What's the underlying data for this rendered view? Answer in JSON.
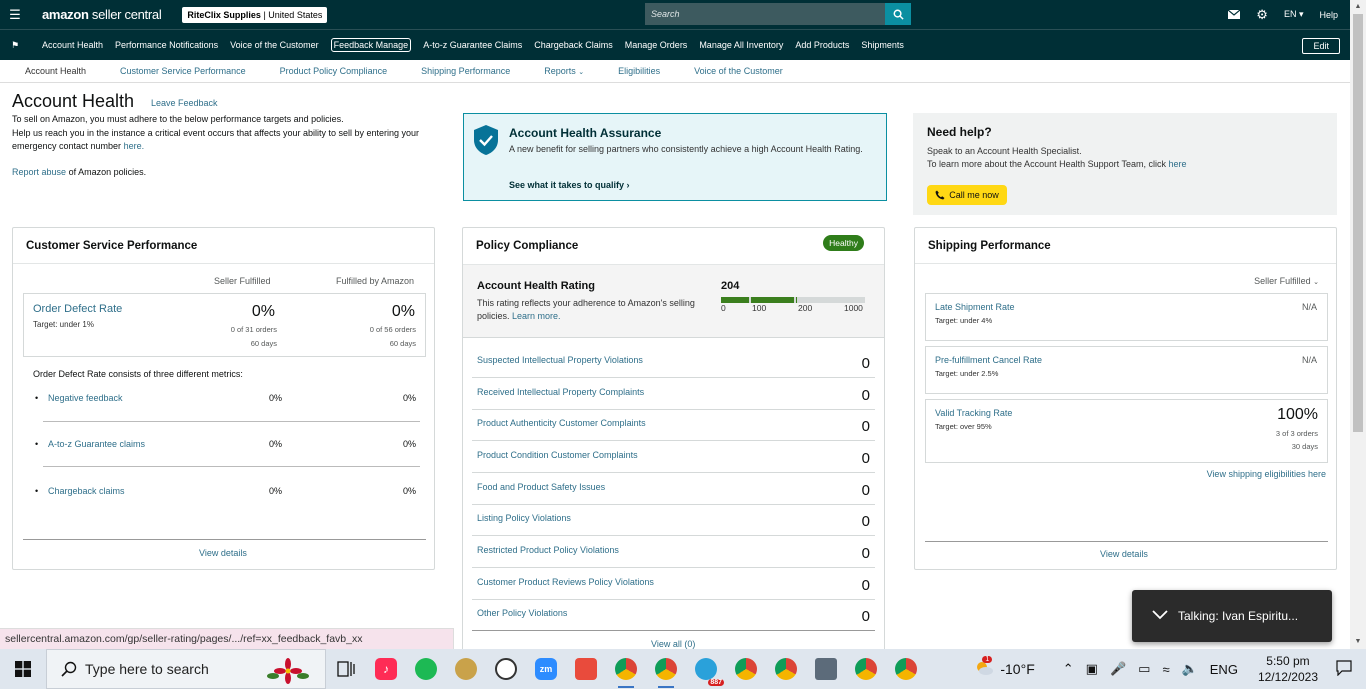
{
  "topbar": {
    "logo": "amazon",
    "logo_suffix": "seller central",
    "store_name": "RiteClix Supplies",
    "store_region": "United States",
    "search_placeholder": "Search",
    "lang": "EN",
    "help": "Help"
  },
  "nav": {
    "items": [
      {
        "label": "Account Health"
      },
      {
        "label": "Performance Notifications"
      },
      {
        "label": "Voice of the Customer"
      },
      {
        "label": "Feedback Manage"
      },
      {
        "label": "A-to-z Guarantee Claims"
      },
      {
        "label": "Chargeback Claims"
      },
      {
        "label": "Manage Orders"
      },
      {
        "label": "Manage All Inventory"
      },
      {
        "label": "Add Products"
      },
      {
        "label": "Shipments"
      }
    ],
    "edit": "Edit"
  },
  "subnav": {
    "items": [
      {
        "label": "Account Health"
      },
      {
        "label": "Customer Service Performance"
      },
      {
        "label": "Product Policy Compliance"
      },
      {
        "label": "Shipping Performance"
      },
      {
        "label": "Reports"
      },
      {
        "label": "Eligibilities"
      },
      {
        "label": "Voice of the Customer"
      }
    ]
  },
  "header": {
    "title": "Account Health",
    "leave_feedback": "Leave Feedback",
    "intro_line1": "To sell on Amazon, you must adhere to the below performance targets and policies.",
    "intro_line2": "Help us reach you in the instance a critical event occurs that affects your ability to sell by entering your emergency contact number",
    "intro_here": "here.",
    "report_link": "Report abuse",
    "report_text": "of Amazon policies."
  },
  "assurance": {
    "title": "Account Health Assurance",
    "desc": "A new benefit for selling partners who consistently achieve a high Account Health Rating.",
    "cta": "See what it takes to qualify"
  },
  "need_help": {
    "title": "Need help?",
    "line1": "Speak to an Account Health Specialist.",
    "line2": "To learn more about the Account Health Support Team, click",
    "here": "here",
    "call": "Call me now"
  },
  "csp": {
    "title": "Customer Service Performance",
    "col1": "Seller Fulfilled",
    "col2": "Fulfilled by Amazon",
    "odr": {
      "name": "Order Defect Rate",
      "target": "Target: under 1%",
      "sf_pct": "0%",
      "sf_orders": "0 of 31 orders",
      "sf_days": "60 days",
      "fba_pct": "0%",
      "fba_orders": "0 of 56 orders",
      "fba_days": "60 days"
    },
    "consists": "Order Defect Rate consists of three different metrics:",
    "metrics": [
      {
        "label": "Negative feedback",
        "sf": "0%",
        "fba": "0%"
      },
      {
        "label": "A-to-z Guarantee claims",
        "sf": "0%",
        "fba": "0%"
      },
      {
        "label": "Chargeback claims",
        "sf": "0%",
        "fba": "0%"
      }
    ],
    "view_details": "View details"
  },
  "policy": {
    "title": "Policy Compliance",
    "badge": "Healthy",
    "ahr_title": "Account Health Rating",
    "ahr_desc": "This rating reflects your adherence to Amazon's selling policies.",
    "learn_more": "Learn more.",
    "score": "204",
    "score_value": 204,
    "ticks": [
      "0",
      "100",
      "200",
      "1000"
    ],
    "rows": [
      {
        "label": "Suspected Intellectual Property Violations",
        "value": "0"
      },
      {
        "label": "Received Intellectual Property Complaints",
        "value": "0"
      },
      {
        "label": "Product Authenticity Customer Complaints",
        "value": "0"
      },
      {
        "label": "Product Condition Customer Complaints",
        "value": "0"
      },
      {
        "label": "Food and Product Safety Issues",
        "value": "0"
      },
      {
        "label": "Listing Policy Violations",
        "value": "0"
      },
      {
        "label": "Restricted Product Policy Violations",
        "value": "0"
      },
      {
        "label": "Customer Product Reviews Policy Violations",
        "value": "0"
      },
      {
        "label": "Other Policy Violations",
        "value": "0"
      }
    ],
    "view_all": "View all (0)"
  },
  "shipping": {
    "title": "Shipping Performance",
    "filter": "Seller Fulfilled",
    "late": {
      "name": "Late Shipment Rate",
      "target": "Target: under 4%",
      "value": "N/A"
    },
    "cancel": {
      "name": "Pre-fulfillment Cancel Rate",
      "target": "Target: under 2.5%",
      "value": "N/A"
    },
    "tracking": {
      "name": "Valid Tracking Rate",
      "target": "Target: over 95%",
      "value": "100%",
      "orders": "3 of 3 orders",
      "days": "30 days"
    },
    "eligibilities": "View shipping eligibilities here",
    "view_details": "View details"
  },
  "status_url": "sellercentral.amazon.com/gp/seller-rating/pages/.../ref=xx_feedback_favb_xx",
  "talking": "Talking: Ivan Espiritu...",
  "taskbar": {
    "search_placeholder": "Type here to search",
    "telegram_badge": "887",
    "weather_badge": "1",
    "temp": "-10°F",
    "lang": "ENG",
    "time": "5:50 pm",
    "date": "12/12/2023"
  }
}
